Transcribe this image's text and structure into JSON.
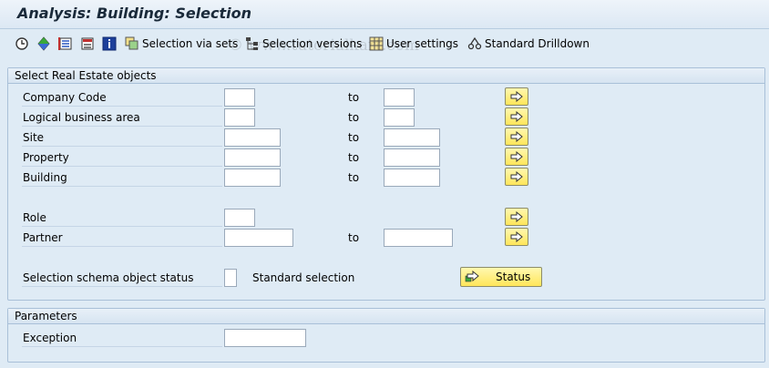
{
  "title": "Analysis: Building: Selection",
  "toolbar": {
    "selection_via_sets": "Selection via sets",
    "selection_versions": "Selection versions",
    "user_settings": "User settings",
    "standard_drilldown": "Standard Drilldown"
  },
  "watermark": "© www.tutorialkart.com",
  "select_group": {
    "title": "Select Real Estate objects",
    "to_label": "to",
    "fields": [
      {
        "label": "Company Code",
        "from": "",
        "to": ""
      },
      {
        "label": "Logical business area",
        "from": "",
        "to": ""
      },
      {
        "label": "Site",
        "from": "",
        "to": ""
      },
      {
        "label": "Property",
        "from": "",
        "to": ""
      },
      {
        "label": "Building",
        "from": "",
        "to": ""
      },
      {
        "label": "Role",
        "from": ""
      },
      {
        "label": "Partner",
        "from": "",
        "to": ""
      }
    ],
    "status_row": {
      "label": "Selection schema object status",
      "value": "",
      "standard_selection": "Standard selection",
      "status_button": "Status"
    }
  },
  "parameters_group": {
    "title": "Parameters",
    "exception_label": "Exception",
    "exception_value": ""
  },
  "colors": {
    "background": "#dfebf5",
    "button_yellow": "#ffe65a",
    "group_border": "#a9c0d8"
  }
}
